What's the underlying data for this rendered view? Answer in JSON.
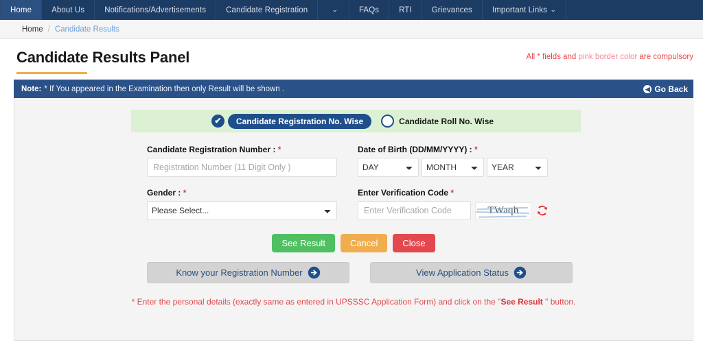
{
  "nav": {
    "items": [
      {
        "label": "Home",
        "active": true,
        "caret": false
      },
      {
        "label": "About Us",
        "active": false,
        "caret": false
      },
      {
        "label": "Notifications/Advertisements",
        "active": false,
        "caret": false
      },
      {
        "label": "Candidate Registration",
        "active": false,
        "caret": false
      },
      {
        "label": "",
        "active": false,
        "caret": true
      },
      {
        "label": "FAQs",
        "active": false,
        "caret": false
      },
      {
        "label": "RTI",
        "active": false,
        "caret": false
      },
      {
        "label": "Grievances",
        "active": false,
        "caret": false
      },
      {
        "label": "Important Links",
        "active": false,
        "caret": true
      }
    ],
    "caret_glyph": "⌄"
  },
  "breadcrumb": {
    "home": "Home",
    "separator": "/",
    "current": "Candidate Results"
  },
  "header": {
    "title": "Candidate Results Panel",
    "compulsory_prefix": "All * fields and ",
    "compulsory_pink": "pink border color",
    "compulsory_suffix": " are compulsory",
    "accent_rule_color": "#f0ad4e"
  },
  "note_bar": {
    "label": "Note:",
    "text": "* If You appeared in the Examination then only Result will be shown .",
    "go_back_label": "Go Back",
    "go_back_icon": "◀",
    "background": "#2b5288"
  },
  "mode_selector": {
    "background": "#dcf0d4",
    "selected_icon": "✔",
    "options": [
      {
        "label": "Candidate Registration No. Wise",
        "selected": true
      },
      {
        "label": "Candidate Roll No. Wise",
        "selected": false
      }
    ]
  },
  "form": {
    "registration": {
      "label": "Candidate Registration Number : ",
      "required": "*",
      "placeholder": "Registration Number (11 Digit Only )",
      "value": ""
    },
    "dob": {
      "label": "Date of Birth (DD/MM/YYYY) : ",
      "required": "*",
      "day": "DAY",
      "month": "MONTH",
      "year": "YEAR"
    },
    "gender": {
      "label": "Gender : ",
      "required": "*",
      "selected": "Please Select..."
    },
    "verification": {
      "label": "Enter Verification Code ",
      "required": "*",
      "placeholder": "Enter Verification Code",
      "value": "",
      "captcha_text": "TWaqh",
      "refresh_icon_color": "#e8201f"
    }
  },
  "buttons": {
    "see_result": {
      "label": "See Result",
      "color": "#4fbf62"
    },
    "cancel": {
      "label": "Cancel",
      "color": "#f0ad4e"
    },
    "close": {
      "label": "Close",
      "color": "#e2484d"
    },
    "know_registration": {
      "label": "Know your Registration Number"
    },
    "view_status": {
      "label": "View Application Status"
    }
  },
  "footer": {
    "prefix": "* Enter the personal details (exactly same as entered in UPSSSC Application Form) and click on the \"",
    "emphasis": "See Result",
    "suffix": " \" button."
  }
}
